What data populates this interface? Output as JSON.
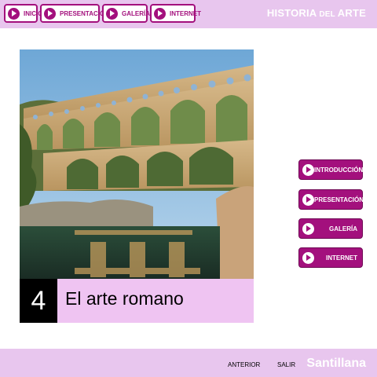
{
  "colors": {
    "accent": "#a3107d",
    "bar": "#e8c6ee",
    "caption_bg": "#efc4f2"
  },
  "header": {
    "nav": [
      {
        "label": "INICIO",
        "icon": "play-icon"
      },
      {
        "label": "PRESENTACIÓN",
        "icon": "play-icon"
      },
      {
        "label": "GALERÍA",
        "icon": "play-icon"
      },
      {
        "label": "INTERNET",
        "icon": "play-icon"
      }
    ],
    "title_main": "HISTORIA",
    "title_small": " DEL ",
    "title_end": "ARTE"
  },
  "main": {
    "image_icon": "aqueduct-photo",
    "chapter_number": "4",
    "chapter_title": "El arte romano"
  },
  "side_menu": [
    {
      "label": "INTRODUCCIÓN",
      "icon": "play-icon"
    },
    {
      "label": "PRESENTACIÓN",
      "icon": "play-icon"
    },
    {
      "label": "GALERÍA",
      "icon": "play-icon"
    },
    {
      "label": "INTERNET",
      "icon": "play-icon"
    }
  ],
  "footer": {
    "prev_label": "ANTERIOR",
    "exit_label": "SALIR",
    "brand": "Santillana"
  }
}
